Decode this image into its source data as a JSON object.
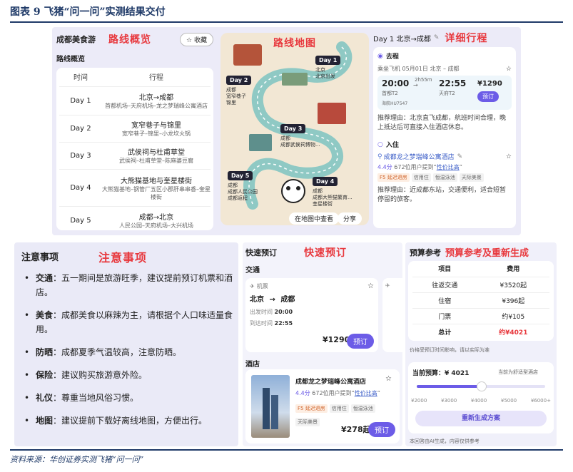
{
  "figure": {
    "title": "图表 9    飞猪“问一问”实测结果交付",
    "source": "资料来源：华创证券实测飞猪“问一问”"
  },
  "top": {
    "trip_title": "成都美食游",
    "annot_route_overview": "路线概览",
    "favorite_label": "收藏",
    "route_overview_label": "路线概览",
    "table_headers": [
      "时间",
      "行程"
    ],
    "rows": [
      {
        "day": "Day 1",
        "main": "北京→成都",
        "sub": "首都机场–天府机场–龙之梦瑞峰公寓酒店"
      },
      {
        "day": "Day 2",
        "main": "宽窄巷子与锦里",
        "sub": "宽窄巷子–锦里–小龙坎火锅"
      },
      {
        "day": "Day 3",
        "main": "武侯祠与杜甫草堂",
        "sub": "武侯祠–杜甫草堂–陈麻婆豆腐"
      },
      {
        "day": "Day 4",
        "main": "大熊猫基地与奎星楼街",
        "sub": "大熊猫基地–钢管厂五区小郡肝串串香–奎星楼街"
      },
      {
        "day": "Day 5",
        "main": "成都→北京",
        "sub": "人民公园–天府机场–大兴机场"
      }
    ],
    "map": {
      "annot": "路线地图",
      "days": [
        {
          "label": "Day 1",
          "text": "北京\n北京出发"
        },
        {
          "label": "Day 2",
          "text": "成都\n宽窄巷子\n锦里"
        },
        {
          "label": "Day 3",
          "text": "成都\n成都武侯祠博物..."
        },
        {
          "label": "Day 4",
          "text": "成都\n成都大熊猫繁育...\n奎星楼街"
        },
        {
          "label": "Day 5",
          "text": "成都\n成都人民公园\n成都返程"
        }
      ],
      "view_map_btn": "在地图中查看",
      "share_btn": "分享"
    },
    "detail": {
      "header": "Day 1 北京→成都",
      "annot": "详细行程",
      "go_label": "去程",
      "flight_meta": "乘坐飞机 05月01日 北京 – 成都",
      "dep_time": "20:00",
      "dep_airport": "首都T2",
      "duration": "2h55m",
      "arr_time": "22:55",
      "arr_airport": "天府T2",
      "flight_no": "海航HU7547",
      "flight_price": "¥1290",
      "book_btn": "预订",
      "reason_go": "推荐理由：北京直飞成都，航班时间合理，晚上抵达后可直接入住酒店休息。",
      "stay_label": "入住",
      "hotel_name": "成都龙之梦瑞峰公寓酒店",
      "hotel_score": "4.4分",
      "hotel_reviews": "672位用户提到“",
      "hotel_link": "性价比高",
      "hotel_tags": [
        "F5 延迟退房",
        "信用住",
        "恒温泳池",
        "天际美景"
      ],
      "reason_stay": "推荐理由：近成都东站，交通便利，适合短暂停留的旅客。"
    }
  },
  "notes": {
    "title": "注意事项",
    "annot": "注意事项",
    "items": [
      {
        "key": "交通",
        "text": "：五一期间是旅游旺季，建议提前预订机票和酒店。"
      },
      {
        "key": "美食",
        "text": "：成都美食以麻辣为主，请根据个人口味适量食用。"
      },
      {
        "key": "防晒",
        "text": "：成都夏季气温较高，注意防晒。"
      },
      {
        "key": "保险",
        "text": "：建议购买旅游意外险。"
      },
      {
        "key": "礼仪",
        "text": "：尊重当地风俗习惯。"
      },
      {
        "key": "地图",
        "text": "：建议提前下载好离线地图，方便出行。"
      }
    ]
  },
  "quick": {
    "title": "快速预订",
    "annot": "快速预订",
    "transport_label": "交通",
    "ticket_type": "机票",
    "route_from": "北京",
    "route_to": "成都",
    "dep_label": "出发时间",
    "dep_time": "20:00",
    "arr_label": "到达时间",
    "arr_time": "22:55",
    "price": "¥1290",
    "book_btn": "预订",
    "hotel_label": "酒店",
    "hotel_name": "成都龙之梦瑞峰公寓酒店",
    "hotel_score": "4.4分",
    "hotel_reviews": "672位用户提到“",
    "hotel_link": "性价比高",
    "hotel_tags": [
      "F5 延迟退房",
      "信用住",
      "恒温泳池",
      "天际美景"
    ],
    "hotel_price": "¥278起",
    "hotel_book_btn": "预订"
  },
  "budget": {
    "title": "预算参考",
    "annot": "预算参考及重新生成",
    "headers": [
      "项目",
      "费用"
    ],
    "rows": [
      {
        "item": "往返交通",
        "cost": "¥3520起"
      },
      {
        "item": "住宿",
        "cost": "¥396起"
      },
      {
        "item": "门票",
        "cost": "约¥105"
      },
      {
        "item": "总计",
        "cost": "约¥4021"
      }
    ],
    "note": "价格受预订时间影响，请以实际为准",
    "current_label": "当前预算：¥ 4021",
    "match_label": "当前为舒适型酒店",
    "slider_value": 4021,
    "slider_ticks": [
      "¥2000",
      "¥3000",
      "¥4000",
      "¥5000",
      "¥6000+"
    ],
    "regen_btn": "重新生成方案",
    "footer": "本回答由AI生成，内容仅供参考"
  }
}
